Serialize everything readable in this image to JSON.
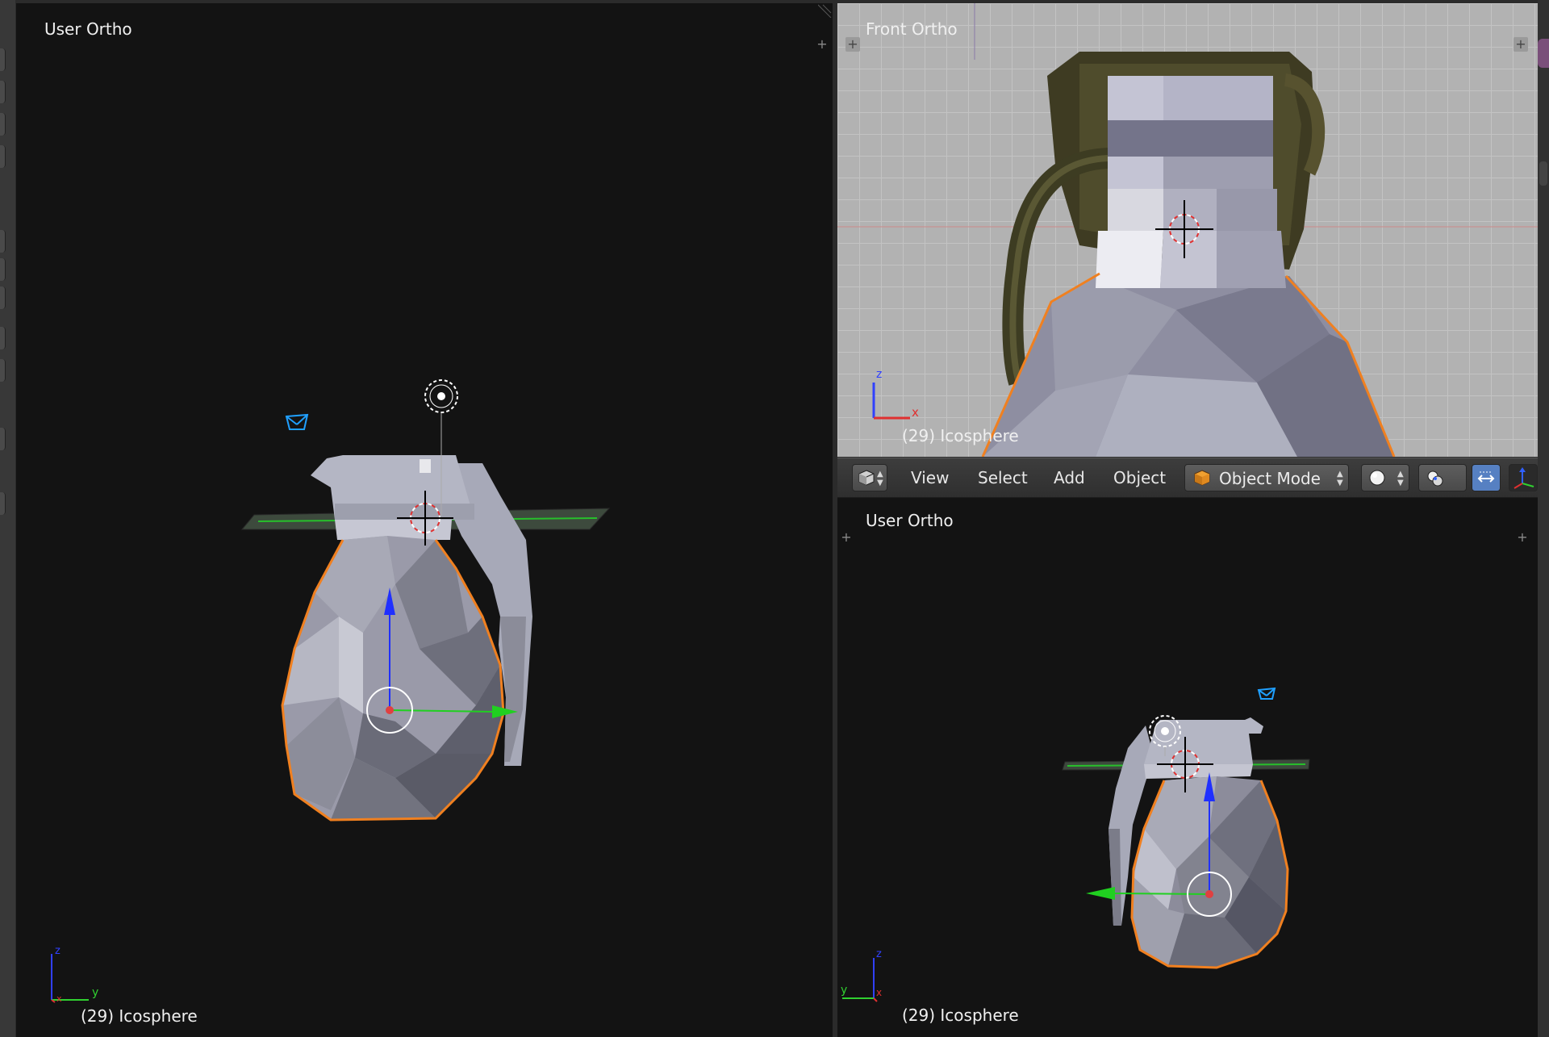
{
  "viewports": {
    "left": {
      "title": "User Ortho",
      "object_label": "(29) Icosphere",
      "axes": {
        "z": "z",
        "y": "y",
        "x": "x"
      }
    },
    "front": {
      "title": "Front Ortho",
      "object_label": "(29) Icosphere",
      "axes": {
        "z": "z",
        "x": "x"
      }
    },
    "bottom": {
      "title": "User Ortho",
      "object_label": "(29) Icosphere",
      "axes": {
        "z": "z",
        "y": "y",
        "x": "x"
      }
    }
  },
  "header": {
    "menu": {
      "view": "View",
      "select": "Select",
      "add": "Add",
      "object": "Object"
    },
    "mode": "Object Mode"
  },
  "icons": {
    "editor_type": "cube-editor-icon",
    "mode": "object-cube-icon",
    "shading": "sphere-shading-icon",
    "pivot": "pivot-point-icon",
    "manipulator": "manipulator-icon",
    "transform_widget": "transform-axes-icon",
    "plus": "plus-icon"
  },
  "colors": {
    "selection_outline": "#f08020",
    "x_axis": "#e03030",
    "y_axis": "#30d030",
    "z_axis": "#3040ff",
    "camera": "#20a0ff",
    "viewport_bg": "#131313",
    "mesh": "#9a9aaa"
  }
}
